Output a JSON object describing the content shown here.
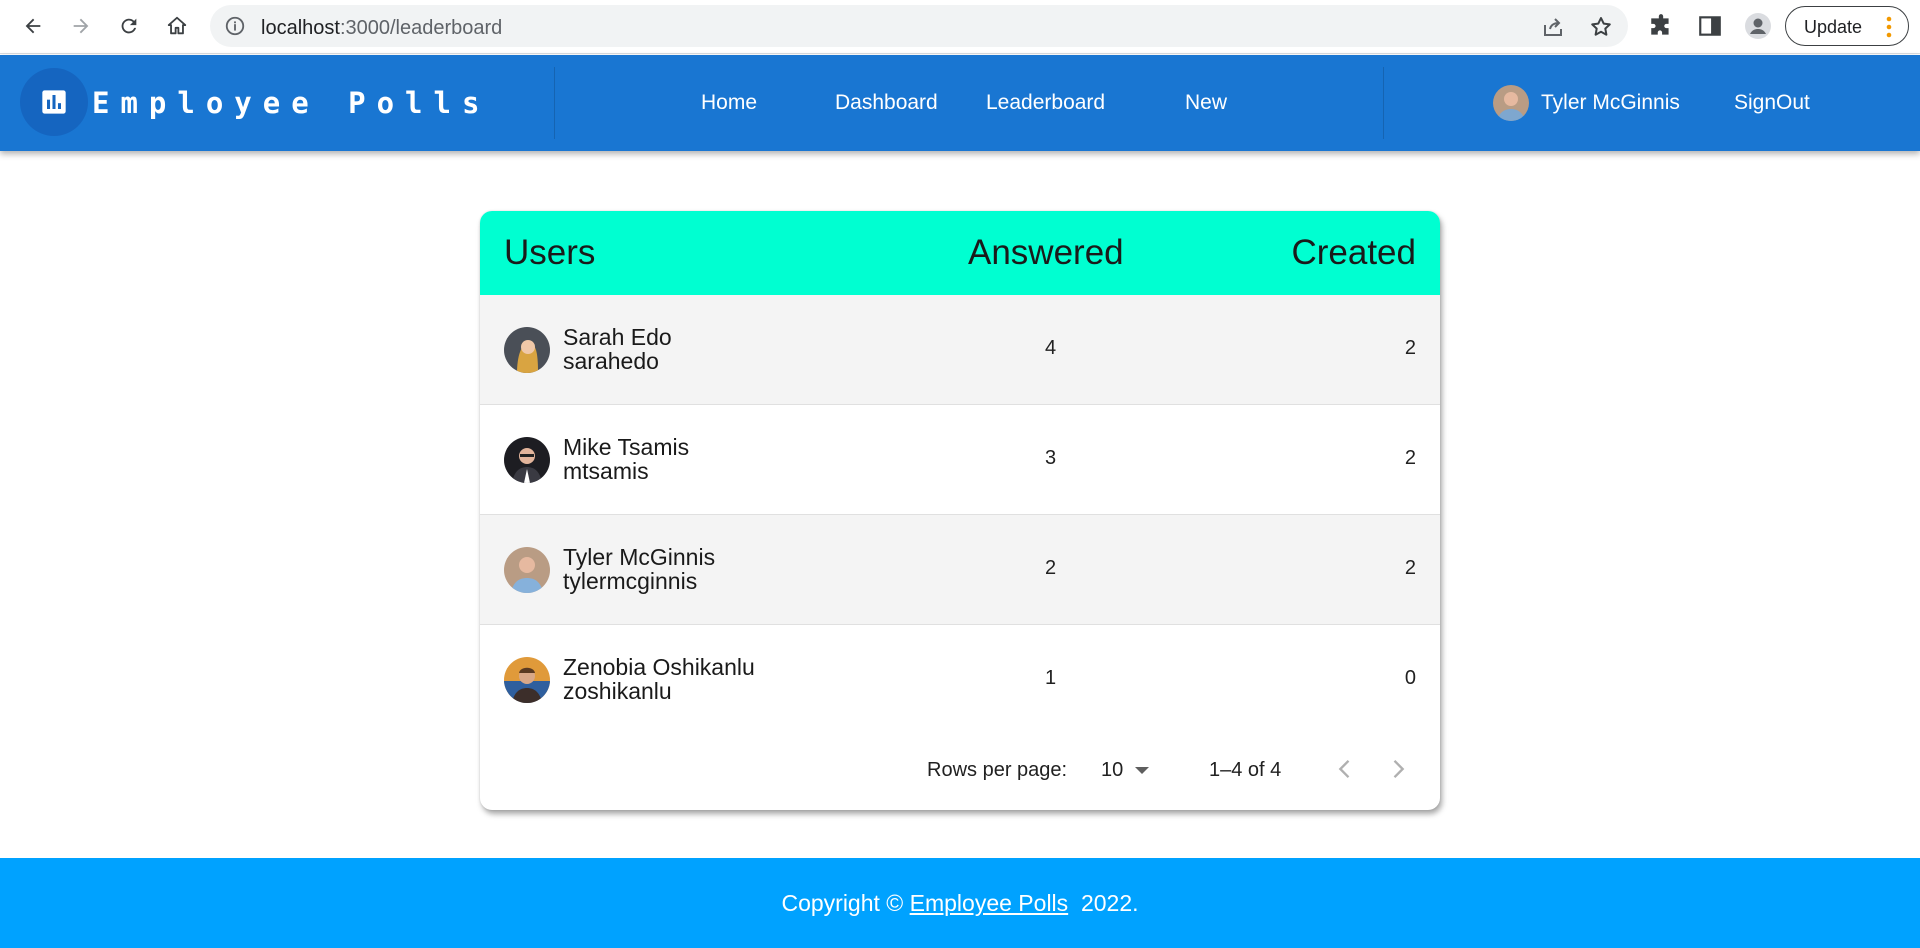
{
  "browser": {
    "url_host": "localhost",
    "url_path": ":3000/leaderboard",
    "update_label": "Update",
    "accent_dots": "#f29900"
  },
  "appbar": {
    "brand": "Employee Polls",
    "nav": [
      "Home",
      "Dashboard",
      "Leaderboard",
      "New"
    ],
    "user_name": "Tyler McGinnis",
    "signout": "SignOut",
    "color": "#1976d2"
  },
  "leaderboard": {
    "headers": {
      "users": "Users",
      "answered": "Answered",
      "created": "Created"
    },
    "header_color": "#00ffd1",
    "rows": [
      {
        "name": "Sarah Edo",
        "id": "sarahedo",
        "answered": "4",
        "created": "2"
      },
      {
        "name": "Mike Tsamis",
        "id": "mtsamis",
        "answered": "3",
        "created": "2"
      },
      {
        "name": "Tyler McGinnis",
        "id": "tylermcginnis",
        "answered": "2",
        "created": "2"
      },
      {
        "name": "Zenobia Oshikanlu",
        "id": "zoshikanlu",
        "answered": "1",
        "created": "0"
      }
    ],
    "pagination": {
      "rows_per_page_label": "Rows per page:",
      "rows_per_page_value": "10",
      "range": "1–4 of 4"
    }
  },
  "footer": {
    "prefix": "Copyright © ",
    "link": "Employee Polls",
    "suffix": "  2022.",
    "color": "#00a2ff"
  }
}
